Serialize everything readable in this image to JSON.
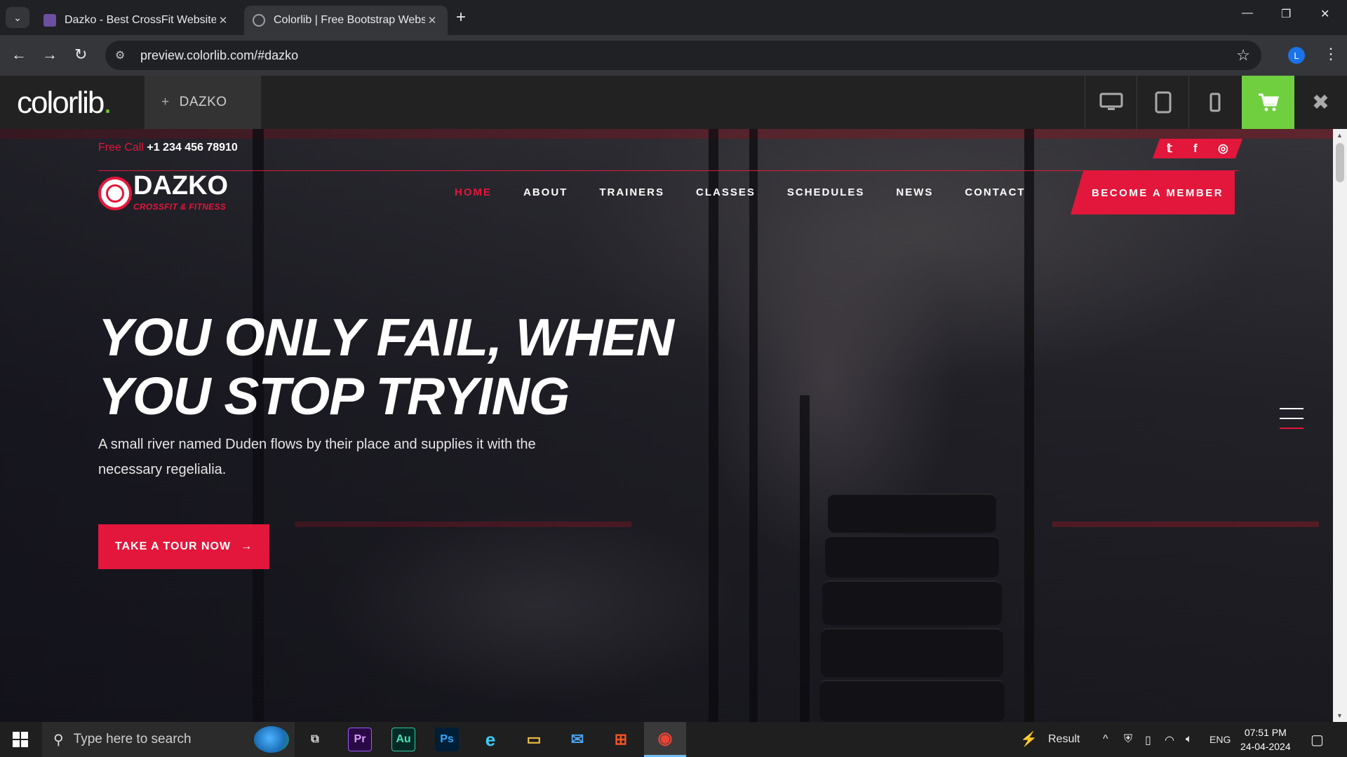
{
  "browser": {
    "tabs": [
      {
        "title": "Dazko - Best CrossFit Website",
        "active": false
      },
      {
        "title": "Colorlib | Free Bootstrap Webs",
        "active": true
      }
    ],
    "url": "preview.colorlib.com/#dazko",
    "profile_initial": "L"
  },
  "colorlib_bar": {
    "logo": "colorlib",
    "logo_dot": ".",
    "theme_label": "DAZKO",
    "theme_plus": "+",
    "devices": [
      "desktop-icon",
      "tablet-icon",
      "mobile-icon"
    ]
  },
  "site": {
    "call_label": "Free Call",
    "call_number": "+1 234 456 78910",
    "social": [
      "twitter-icon",
      "facebook-icon",
      "instagram-icon"
    ],
    "social_glyphs": [
      "𝕥",
      "f",
      "◎"
    ],
    "logo_name": "DAZKO",
    "logo_tagline": "CROSSFIT & FITNESS",
    "nav": [
      {
        "label": "HOME",
        "active": true
      },
      {
        "label": "ABOUT",
        "active": false
      },
      {
        "label": "TRAINERS",
        "active": false
      },
      {
        "label": "CLASSES",
        "active": false
      },
      {
        "label": "SCHEDULES",
        "active": false
      },
      {
        "label": "NEWS",
        "active": false
      },
      {
        "label": "CONTACT",
        "active": false
      }
    ],
    "cta_member": "BECOME A MEMBER",
    "headline_line1": "YOU ONLY FAIL, WHEN",
    "headline_line2": "YOU STOP TRYING",
    "subtitle": "A small river named Duden flows by their place and supplies it with the necessary regelialia.",
    "tour_button": "TAKE A TOUR NOW",
    "tour_arrow": "→"
  },
  "taskbar": {
    "search_placeholder": "Type here to search",
    "apps": [
      {
        "name": "task-view-icon",
        "label": "⧉"
      },
      {
        "name": "premiere-icon",
        "label": "Pr"
      },
      {
        "name": "audition-icon",
        "label": "Au"
      },
      {
        "name": "photoshop-icon",
        "label": "Ps"
      },
      {
        "name": "edge-icon",
        "label": "e"
      },
      {
        "name": "file-explorer-icon",
        "label": "▭"
      },
      {
        "name": "mail-icon",
        "label": "✉"
      },
      {
        "name": "store-icon",
        "label": "⊞"
      },
      {
        "name": "chrome-icon",
        "label": "◉"
      }
    ],
    "result_label": "Result",
    "language": "ENG",
    "time": "07:51 PM",
    "date": "24-04-2024"
  },
  "colors": {
    "accent": "#e2173b",
    "colorlib_green": "#6fcf3e"
  }
}
